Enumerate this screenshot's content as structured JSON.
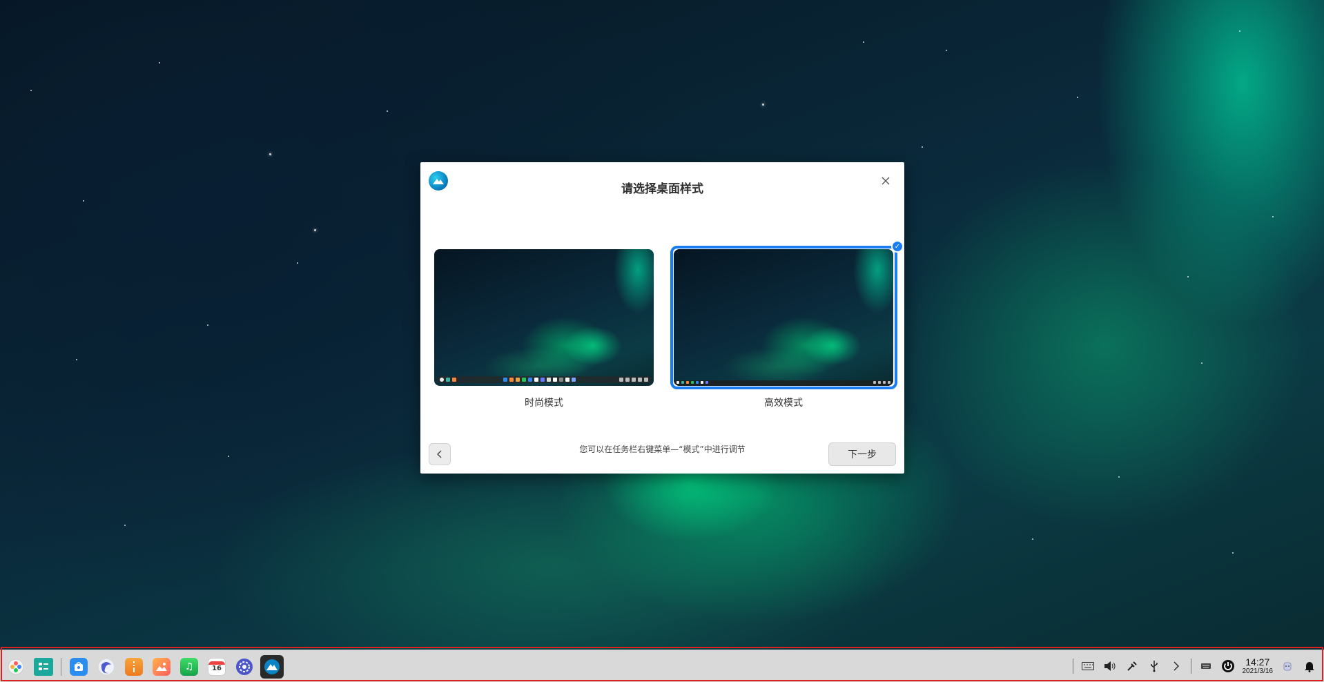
{
  "dialog": {
    "title": "请选择桌面样式",
    "hint": "您可以在任务栏右键菜单—“模式”中进行调节",
    "next_label": "下一步",
    "modes": [
      {
        "label": "时尚模式",
        "selected": false
      },
      {
        "label": "高效模式",
        "selected": true
      }
    ]
  },
  "taskbar": {
    "apps": [
      {
        "name": "launcher",
        "icon": "launcher-icon"
      },
      {
        "name": "multitask-view",
        "icon": "multitask-view-icon"
      },
      {
        "name": "app-store",
        "icon": "app-store-icon"
      },
      {
        "name": "browser",
        "icon": "browser-icon"
      },
      {
        "name": "archive-manager",
        "icon": "archive-icon"
      },
      {
        "name": "image-viewer",
        "icon": "photos-icon"
      },
      {
        "name": "music",
        "icon": "music-icon"
      },
      {
        "name": "calendar",
        "icon": "calendar-icon"
      },
      {
        "name": "control-center",
        "icon": "settings-icon"
      },
      {
        "name": "welcome",
        "icon": "welcome-app-icon"
      }
    ],
    "calendar_day": "16",
    "clock": {
      "time": "14:27",
      "date": "2021/3/16"
    }
  },
  "colors": {
    "accent": "#1a7cf2",
    "taskbar_outline": "#e0201c"
  }
}
